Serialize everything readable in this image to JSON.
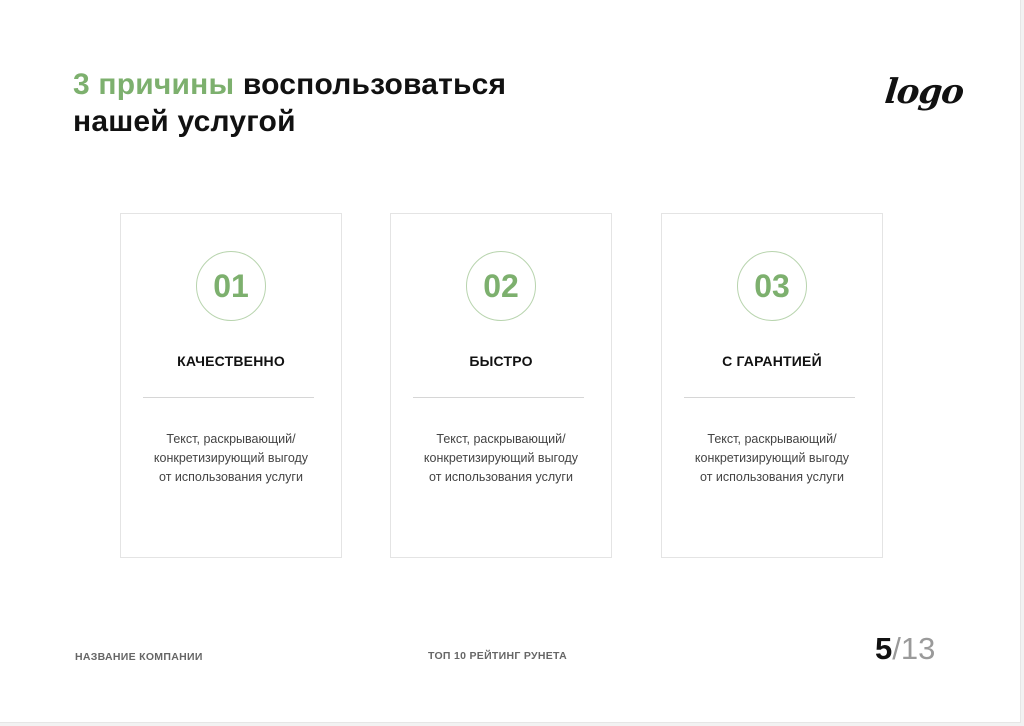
{
  "header": {
    "title_accent": "3 причины",
    "title_line1_rest": "воспользоваться",
    "title_line2": "нашей услугой",
    "logo": "logo"
  },
  "cards": [
    {
      "number": "01",
      "heading": "КАЧЕСТВЕННО",
      "desc_line1": "Текст, раскрывающий/",
      "desc_line2": "конкретизирующий выгоду",
      "desc_line3": "от использования услуги"
    },
    {
      "number": "02",
      "heading": "БЫСТРО",
      "desc_line1": "Текст, раскрывающий/",
      "desc_line2": "конкретизирующий выгоду",
      "desc_line3": "от использования услуги"
    },
    {
      "number": "03",
      "heading": "С ГАРАНТИЕЙ",
      "desc_line1": "Текст, раскрывающий/",
      "desc_line2": "конкретизирующий выгоду",
      "desc_line3": "от использования услуги"
    }
  ],
  "footer": {
    "company": "НАЗВАНИЕ КОМПАНИИ",
    "tagline": "ТОП 10 РЕЙТИНГ РУНЕТА",
    "page_current": "5",
    "page_separator": "/",
    "page_total": "13"
  },
  "colors": {
    "accent": "#7db06e",
    "circle_border": "#b8d4ae",
    "text": "#111111",
    "muted": "#666666"
  }
}
